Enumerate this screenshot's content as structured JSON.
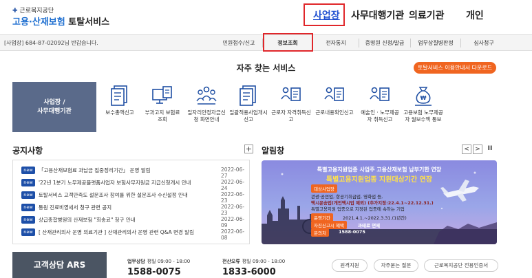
{
  "header": {
    "org_small": "근로복지공단",
    "title_part1": "고용·산재보험",
    "title_part2": "토탈서비스"
  },
  "topnav": [
    "사업장",
    "사무대행기관",
    "의료기관",
    "개인"
  ],
  "greeting": "[사업장] 684-87-02092님 반갑습니다.",
  "subnav": [
    "민원접수/신고",
    "정보조회",
    "전자통지",
    "증명원 신청/발급",
    "업무상질병판정",
    "심사청구"
  ],
  "services": {
    "title": "자주 찾는 서비스",
    "download_button": "토탈서비스 이용안내서 다운로드",
    "side_panel_line1": "사업장 /",
    "side_panel_line2": "사무대행기관",
    "items": [
      {
        "label": "보수총액신고",
        "icon": "document-list-icon"
      },
      {
        "label": "부과고지 보험료 조회",
        "icon": "monitor-document-icon"
      },
      {
        "label": "일자리안정자금신청 화면안내",
        "icon": "people-group-icon"
      },
      {
        "label": "일괄적용사업개시신고",
        "icon": "document-list-icon"
      },
      {
        "label": "근로자 자격취득신고",
        "icon": "person-document-icon"
      },
      {
        "label": "근로내용확인신고",
        "icon": "person-document-icon"
      },
      {
        "label": "예술인 · 노무제공자 취득신고",
        "icon": "person-document-icon"
      },
      {
        "label": "고용보험 노무제공자 월보수액 통보",
        "icon": "money-bag-icon"
      }
    ]
  },
  "notices": {
    "title": "공지사항",
    "badge": "new",
    "items": [
      {
        "title": "「고용산재보험료 과납금 집중정리기간」 운영 알림",
        "date": "2022-06-27"
      },
      {
        "title": "'22년 1분기 노무제공플랫폼사업자 보험사무지원금 지급신청개시 안내",
        "date": "2022-06-24"
      },
      {
        "title": "토탈서비스 고객만족도 설문조사 참여를 위한 설문조사 수신설정 안내",
        "date": "2022-06-23"
      },
      {
        "title": "통원 진료비영세서 청구 관련 공지",
        "date": "2022-06-23"
      },
      {
        "title": "상급종합병원의 산재보험 \"회송료\" 청구 안내",
        "date": "2022-06-09"
      },
      {
        "title": "[ 산재관리의사 운영 의료기관 ] 산재관리의사 운영 관련 Q&A 변경 알림",
        "date": "2022-06-08"
      }
    ]
  },
  "alarm": {
    "title": "알림창",
    "banner": {
      "headline1": "특별고용지원업종 사업주 고용산재보험 납부기한 연장",
      "headline2": "특별고용지원업종 지원대상기간 연장",
      "target_label": "대상사업장",
      "target_text1": "관광·공연업, 항공기취급업, 영화업 등,",
      "target_text2": "택시운송업(개인택시업 제외) (추가지정:22.4.1~22.12.31.)",
      "target_text3": "특별고용지원 업종으로 지정된 업종에 속하는 기업",
      "period_label": "운영기간",
      "period_text": "2021.4.1.~2022.3.31.(1년간)",
      "benefit_label": "자진신고시 혜택",
      "benefit_text": "과태료 면제",
      "inquiry_label": "문의처",
      "inquiry_text": "1588-0075"
    }
  },
  "contact": {
    "ars_label": "고객상담 ARS",
    "c1_label": "업무상담",
    "c1_hours": "평일 09:00 - 18:00",
    "c1_number": "1588-0075",
    "c2_label": "전산오류",
    "c2_hours": "평일 09:00 - 18:00",
    "c2_number": "1833-6000",
    "buttons": [
      "원격지원",
      "자주묻는 질문",
      "근로복지공단 전용인증서"
    ]
  },
  "colors": {
    "brand_blue": "#1f4fa3",
    "highlight_red": "#e0262a",
    "download_orange": "#f06520",
    "side_panel": "#5a6a8a",
    "badge_navy": "#1d4fa8"
  }
}
